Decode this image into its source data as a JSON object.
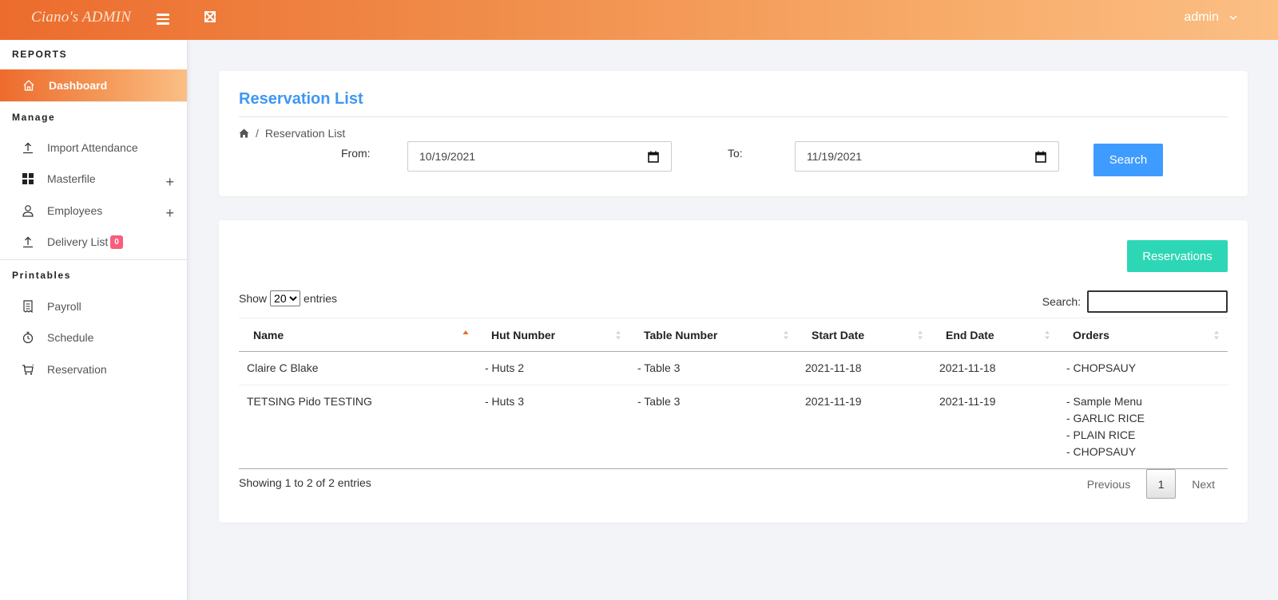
{
  "topbar": {
    "brand": "Ciano's ADMIN",
    "user": "admin"
  },
  "sidebar": {
    "sections": [
      {
        "title": "REPORTS"
      },
      {
        "title": "Manage"
      },
      {
        "title": "Printables"
      }
    ],
    "active_item": {
      "label": "Dashboard",
      "icon": "home-icon"
    },
    "manage_items": [
      {
        "label": "Import Attendance",
        "icon": "upload-icon"
      },
      {
        "label": "Masterfile",
        "icon": "grid-icon",
        "expandable": "+"
      },
      {
        "label": "Employees",
        "icon": "user-icon",
        "expandable": "+"
      },
      {
        "label": "Delivery List",
        "icon": "upload-icon",
        "badge": "0"
      }
    ],
    "printable_items": [
      {
        "label": "Payroll",
        "icon": "receipt-icon"
      },
      {
        "label": "Schedule",
        "icon": "stopwatch-icon"
      },
      {
        "label": "Reservation",
        "icon": "cart-icon"
      }
    ]
  },
  "header_card": {
    "title": "Reservation List",
    "breadcrumb": {
      "separator": "/",
      "current": "Reservation List"
    },
    "from_label": "From:",
    "from_value": "10/19/2021",
    "to_label": "To:",
    "to_value": "11/19/2021",
    "search_button": "Search"
  },
  "table_card": {
    "reservations_button": "Reservations",
    "show_label": "Show",
    "entries_label": "entries",
    "page_size": "20",
    "search_label": "Search:",
    "search_value": "",
    "columns": [
      "Name",
      "Hut Number",
      "Table Number",
      "Start Date",
      "End Date",
      "Orders"
    ],
    "rows": [
      {
        "name": "Claire C Blake",
        "hut": "- Huts 2",
        "table": "- Table 3",
        "start": "2021-11-18",
        "end": "2021-11-18",
        "orders": [
          "- CHOPSAUY"
        ]
      },
      {
        "name": "TETSING Pido TESTING",
        "hut": "- Huts 3",
        "table": "- Table 3",
        "start": "2021-11-19",
        "end": "2021-11-19",
        "orders": [
          "- Sample Menu",
          "- GARLIC RICE",
          "- PLAIN RICE",
          "- CHOPSAUY"
        ]
      }
    ],
    "info": "Showing 1 to 2 of 2 entries",
    "pagination": {
      "previous": "Previous",
      "current": "1",
      "next": "Next"
    }
  },
  "colors": {
    "topbar_start": "#ec6c2d",
    "topbar_end": "#fbbf84",
    "title_blue": "#3e97f4",
    "search_btn": "#3e9bff",
    "reservations_btn": "#2dd7b5",
    "badge": "#fb5c7c",
    "sort_active": "#f06a1f"
  }
}
